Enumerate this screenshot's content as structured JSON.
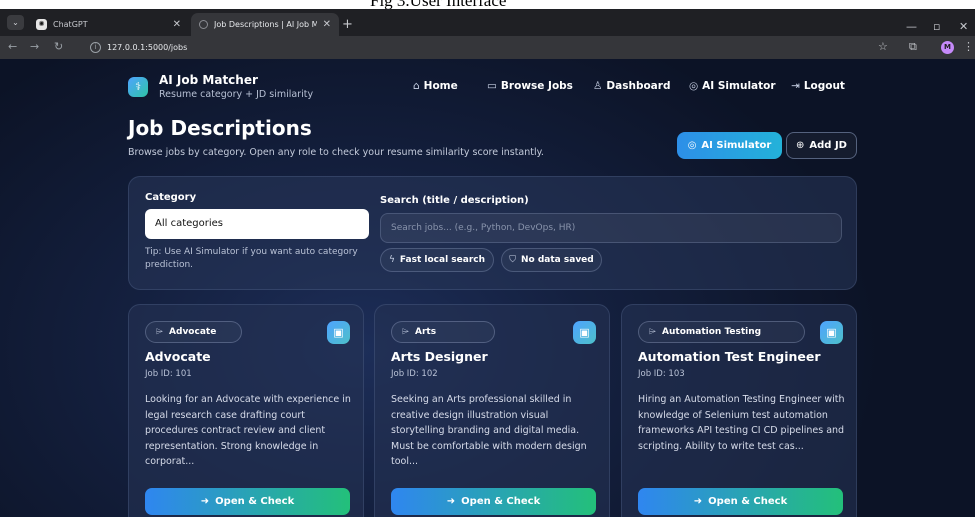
{
  "caption": "Fig 3.User Interface",
  "browser": {
    "tabs": [
      {
        "label": "ChatGPT",
        "favicon": "chatgpt-icon"
      },
      {
        "label": "Job Descriptions | AI Job Matcher",
        "favicon": "globe-icon",
        "active": true
      }
    ],
    "url": "127.0.0.1:5000/jobs",
    "profile_initial": "M"
  },
  "brand": {
    "title": "AI Job Matcher",
    "subtitle": "Resume category + JD similarity"
  },
  "nav": {
    "items": [
      {
        "label": "Home",
        "icon": "home-icon"
      },
      {
        "label": "Browse Jobs",
        "icon": "briefcase-icon"
      },
      {
        "label": "Dashboard",
        "icon": "user-icon"
      },
      {
        "label": "AI Simulator",
        "icon": "target-icon"
      },
      {
        "label": "Logout",
        "icon": "logout-icon"
      }
    ]
  },
  "page": {
    "title": "Job Descriptions",
    "subtitle": "Browse jobs by category. Open any role to check your resume similarity score instantly.",
    "simulator_button": "AI Simulator",
    "add_button": "Add JD"
  },
  "filters": {
    "category_label": "Category",
    "category_value": "All categories",
    "tip": "Tip: Use AI Simulator if you want auto category prediction.",
    "search_label": "Search (title / description)",
    "search_placeholder": "Search jobs... (e.g., Python, DevOps, HR)",
    "pills": [
      "Fast local search",
      "No data saved"
    ]
  },
  "jobs": [
    {
      "category": "Advocate",
      "title": "Advocate",
      "id_text": "Job ID: 101",
      "description": "Looking for an Advocate with experience in legal research case drafting court procedures contract review and client representation. Strong knowledge in corporat...",
      "button": "Open & Check"
    },
    {
      "category": "Arts",
      "title": "Arts Designer",
      "id_text": "Job ID: 102",
      "description": "Seeking an Arts professional skilled in creative design illustration visual storytelling branding and digital media. Must be comfortable with modern design tool...",
      "button": "Open & Check"
    },
    {
      "category": "Automation Testing",
      "title": "Automation Test Engineer",
      "id_text": "Job ID: 103",
      "description": "Hiring an Automation Testing Engineer with knowledge of Selenium test automation frameworks API testing CI CD pipelines and scripting. Ability to write test cas...",
      "button": "Open & Check"
    }
  ],
  "colors": {
    "accent": "#2d8fe8",
    "success": "#23c07a",
    "background": "#14203f"
  }
}
